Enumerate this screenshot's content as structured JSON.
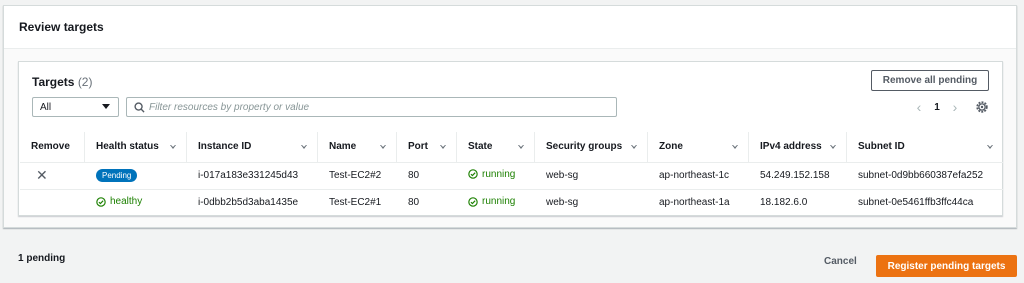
{
  "review": {
    "title": "Review targets"
  },
  "targets": {
    "title": "Targets",
    "count": "(2)",
    "remove_all_label": "Remove all pending",
    "filter_select_value": "All",
    "filter_placeholder": "Filter resources by property or value",
    "page": "1",
    "columns": [
      "Remove",
      "Health status",
      "Instance ID",
      "Name",
      "Port",
      "State",
      "Security groups",
      "Zone",
      "IPv4 address",
      "Subnet ID"
    ],
    "rows": [
      {
        "remove": "✕",
        "health": "Pending",
        "instance_id": "i-017a183e331245d43",
        "name": "Test-EC2#2",
        "port": "80",
        "state": "running",
        "security_groups": "web-sg",
        "zone": "ap-northeast-1c",
        "ipv4": "54.249.152.158",
        "subnet": "subnet-0d9bb660387efa252"
      },
      {
        "remove": "",
        "health": "healthy",
        "instance_id": "i-0dbb2b5d3aba1435e",
        "name": "Test-EC2#1",
        "port": "80",
        "state": "running",
        "security_groups": "web-sg",
        "zone": "ap-northeast-1a",
        "ipv4": "18.182.6.0",
        "subnet": "subnet-0e5461ffb3ffc44ca"
      }
    ]
  },
  "footer": {
    "pending_text": "1 pending",
    "cancel_label": "Cancel",
    "register_label": "Register pending targets"
  },
  "colors": {
    "primary": "#ec7211",
    "badge": "#0073bb",
    "success": "#1d8102"
  }
}
